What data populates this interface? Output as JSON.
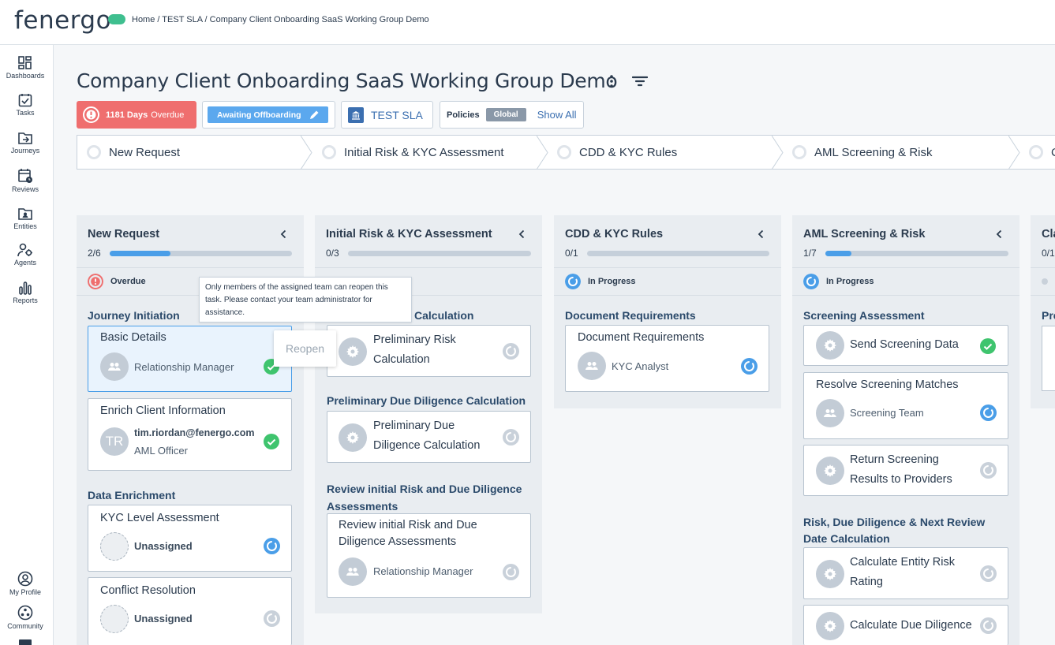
{
  "app": {
    "logo_text": "fenergo"
  },
  "breadcrumb": "Home / TEST SLA / Company Client Onboarding SaaS Working Group Demo",
  "sidebar": {
    "items": [
      {
        "label": "Dashboards",
        "icon": "dashboard-icon"
      },
      {
        "label": "Tasks",
        "icon": "tasks-icon"
      },
      {
        "label": "Journeys",
        "icon": "journeys-icon"
      },
      {
        "label": "Reviews",
        "icon": "reviews-icon"
      },
      {
        "label": "Entities",
        "icon": "entities-icon"
      },
      {
        "label": "Agents",
        "icon": "agents-icon"
      },
      {
        "label": "Reports",
        "icon": "reports-icon"
      }
    ],
    "bottom": [
      {
        "label": "My Profile",
        "icon": "profile-icon"
      },
      {
        "label": "Community",
        "icon": "community-icon"
      }
    ]
  },
  "page": {
    "title": "Company Client Onboarding SaaS Working Group Demo",
    "overdue_days": "1181 Days",
    "overdue_label": "Overdue",
    "status": "Awaiting Offboarding",
    "sla": "TEST SLA",
    "policies_label": "Policies",
    "policies_value": "Global",
    "show_all": "Show All"
  },
  "stages": [
    "New Request",
    "Initial Risk & KYC Assessment",
    "CDD & KYC Rules",
    "AML Screening & Risk",
    "C"
  ],
  "columns": [
    {
      "title": "New Request",
      "count": "2/6",
      "progress": 0.33,
      "status": "Overdue",
      "groups": [
        {
          "name": "Journey Initiation",
          "tasks": [
            {
              "title": "Basic Details",
              "assignee": "Relationship Manager",
              "state": "done"
            },
            {
              "title": "Enrich Client Information",
              "assignee_bold": "tim.riordan@fenergo.com",
              "assignee": "AML Officer",
              "initials": "TR",
              "state": "done"
            }
          ]
        },
        {
          "name": "Data Enrichment",
          "tasks": [
            {
              "title": "KYC Level Assessment",
              "assignee": "Unassigned",
              "state": "in-progress"
            },
            {
              "title": "Conflict Resolution",
              "assignee": "Unassigned",
              "state": "pending"
            }
          ]
        }
      ]
    },
    {
      "title": "Initial Risk & KYC Assessment",
      "count": "0/3",
      "progress": 0,
      "status": "",
      "groups": [
        {
          "name": "Calculation",
          "tasks": [
            {
              "title": "Preliminary Risk Calculation",
              "state": "pending"
            }
          ]
        },
        {
          "name": "Preliminary Due Diligence Calculation",
          "tasks": [
            {
              "title": "Preliminary Due Diligence Calculation",
              "state": "pending"
            }
          ]
        },
        {
          "name": "Review initial Risk and Due Diligence Assessments",
          "tasks": [
            {
              "title": "Review initial Risk and Due Diligence Assessments",
              "assignee": "Relationship Manager",
              "state": "pending"
            }
          ]
        }
      ]
    },
    {
      "title": "CDD & KYC Rules",
      "count": "0/1",
      "progress": 0,
      "status": "In Progress",
      "groups": [
        {
          "name": "Document Requirements",
          "tasks": [
            {
              "title": "Document Requirements",
              "assignee": "KYC Analyst",
              "state": "in-progress"
            }
          ]
        }
      ]
    },
    {
      "title": "AML Screening & Risk",
      "count": "1/7",
      "progress": 0.14,
      "status": "In Progress",
      "groups": [
        {
          "name": "Screening Assessment",
          "tasks": [
            {
              "title": "Send Screening Data",
              "state": "done"
            },
            {
              "title": "Resolve Screening Matches",
              "assignee": "Screening Team",
              "state": "in-progress"
            },
            {
              "title": "Return Screening Results to Providers",
              "state": "pending"
            }
          ]
        },
        {
          "name": "Risk, Due Diligence & Next Review Date Calculation",
          "tasks": [
            {
              "title": "Calculate Entity Risk Rating",
              "state": "pending"
            },
            {
              "title": "Calculate Due Diligence",
              "state": "pending"
            }
          ]
        }
      ]
    },
    {
      "title": "Cla",
      "count": "0/1",
      "group_partial": "Pre"
    }
  ],
  "tooltip": "Only members of the assigned team can reopen this task. Please contact your team administrator for assistance.",
  "reopen": "Reopen",
  "colors": {
    "accent": "#4a9ee8",
    "overdue": "#ef6e6e",
    "done": "#3fc46e",
    "brand": "#3fbf8f"
  }
}
